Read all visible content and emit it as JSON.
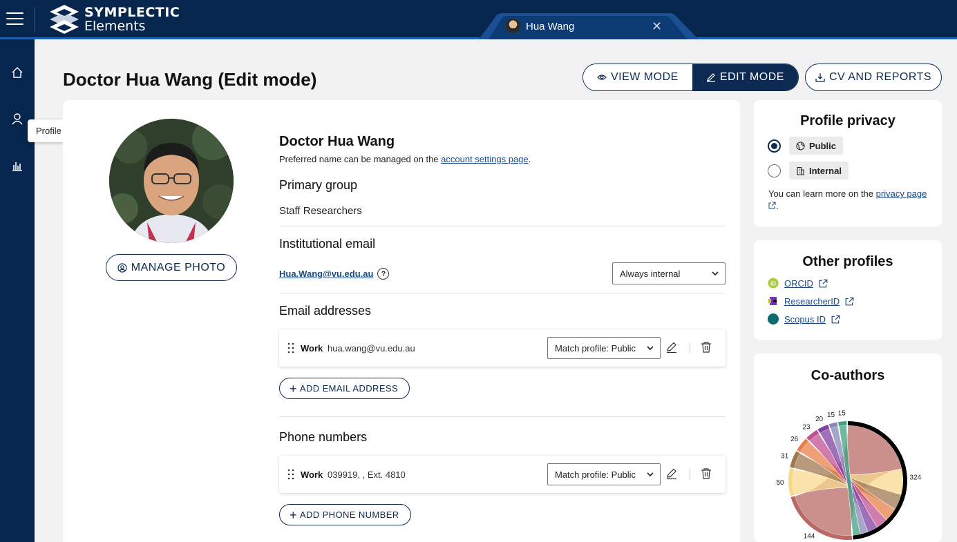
{
  "app": {
    "brand_line1": "SYMPLECTIC",
    "brand_line2": "Elements",
    "active_user_tab": "Hua Wang"
  },
  "sidebar": {
    "tooltip": "Profile"
  },
  "header": {
    "title": "Doctor Hua Wang (Edit mode)",
    "view_mode": "VIEW MODE",
    "edit_mode": "EDIT MODE",
    "cv_reports": "CV AND REPORTS"
  },
  "profile": {
    "manage_photo": "MANAGE PHOTO",
    "name": "Doctor Hua Wang",
    "pref_note_prefix": "Preferred name can be managed on the ",
    "pref_note_link": "account settings page",
    "pref_note_suffix": ".",
    "primary_group_heading": "Primary group",
    "primary_group_value": "Staff Researchers",
    "inst_email_heading": "Institutional email",
    "inst_email_value": "Hua.Wang@vu.edu.au",
    "inst_email_visibility": "Always internal",
    "email_heading": "Email addresses",
    "emails": [
      {
        "label": "Work",
        "value": "hua.wang@vu.edu.au",
        "visibility": "Match profile: Public"
      }
    ],
    "add_email": "ADD EMAIL ADDRESS",
    "phone_heading": "Phone numbers",
    "phones": [
      {
        "label": "Work",
        "value": "039919, , Ext. 4810",
        "visibility": "Match profile: Public"
      }
    ],
    "add_phone": "ADD PHONE NUMBER"
  },
  "privacy": {
    "title": "Profile privacy",
    "options": [
      {
        "label": "Public",
        "selected": true
      },
      {
        "label": "Internal",
        "selected": false
      }
    ],
    "note_prefix": "You can learn more on the ",
    "note_link": "privacy page",
    "note_suffix": "."
  },
  "other_profiles": {
    "title": "Other profiles",
    "links": [
      {
        "label": "ORCID",
        "color": "#a6ce39"
      },
      {
        "label": "ResearcherID",
        "color": "#7b2fbe"
      },
      {
        "label": "Scopus ID",
        "color": "#0a6b6b"
      }
    ]
  },
  "coauthors": {
    "title": "Co-authors",
    "chart_data": {
      "type": "chord",
      "segments": [
        {
          "label": "324",
          "value": 324,
          "color": "#b96a66"
        },
        {
          "label": "144",
          "value": 144,
          "color": "#b96a66"
        },
        {
          "label": "50",
          "value": 50,
          "color": "#f7d98d"
        },
        {
          "label": "31",
          "value": 31,
          "color": "#a07850"
        },
        {
          "label": "26",
          "value": 26,
          "color": "#e8804a"
        },
        {
          "label": "23",
          "value": 23,
          "color": "#c05090"
        },
        {
          "label": "20",
          "value": 20,
          "color": "#8040a0"
        },
        {
          "label": "15",
          "value": 15,
          "color": "#8888b8"
        },
        {
          "label": "15",
          "value": 15,
          "color": "#40a080"
        }
      ]
    }
  }
}
